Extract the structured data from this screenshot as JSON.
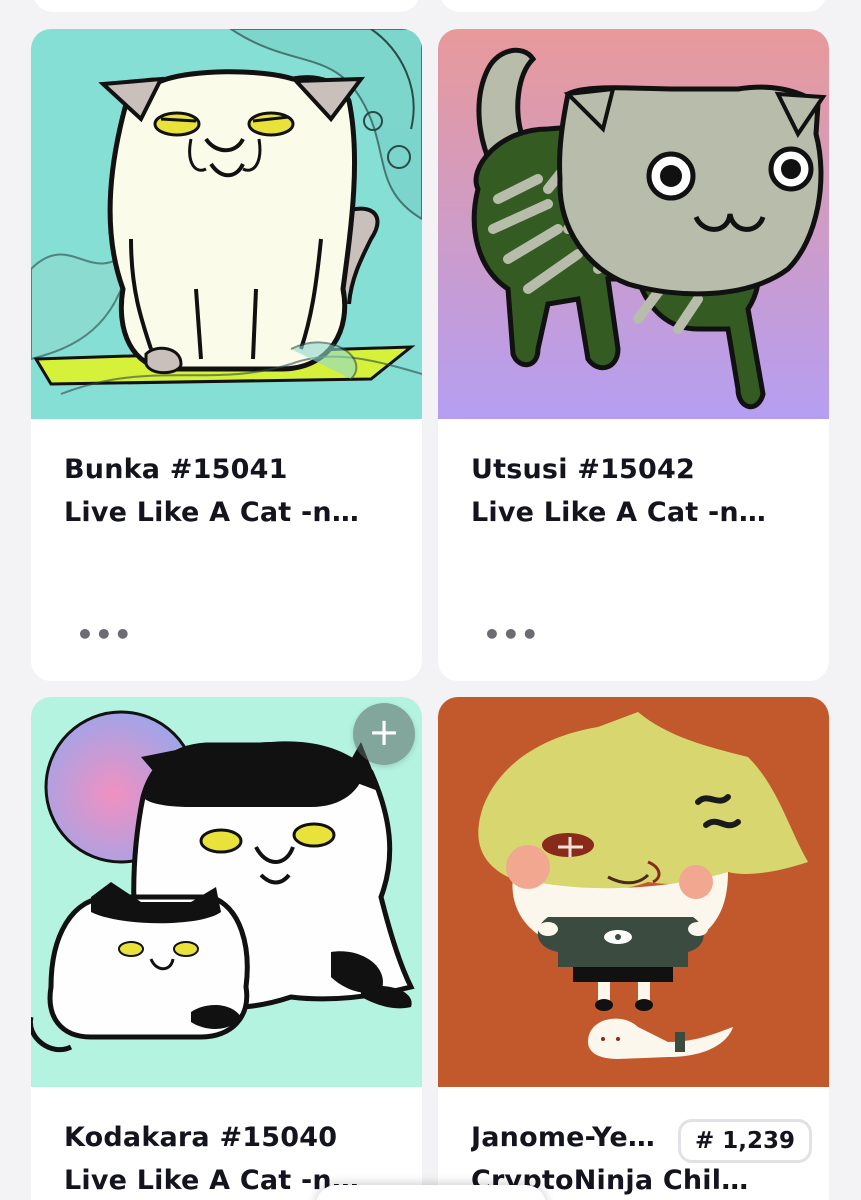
{
  "cards": [
    {
      "title": "Bunka #15041",
      "collection": "Live Like A Cat -n…",
      "more_label": "•••",
      "art_icon": "cat-nft-art"
    },
    {
      "title": "Utsusi #15042",
      "collection": "Live Like A Cat -n…",
      "more_label": "•••",
      "art_icon": "cat-nft-art"
    },
    {
      "title": "Kodakara #15040",
      "collection": "Live Like A Cat -n…",
      "plus_label": "+",
      "art_icon": "cat-family-nft-art"
    },
    {
      "title": "Janome-Ye…",
      "collection": "CryptoNinja Chil…",
      "rank_badge": "# 1,239",
      "art_icon": "ninja-child-nft-art"
    }
  ],
  "colors": {
    "background": "#f3f3f5",
    "card": "#ffffff",
    "text": "#14141f",
    "muted": "#6b6b73"
  }
}
